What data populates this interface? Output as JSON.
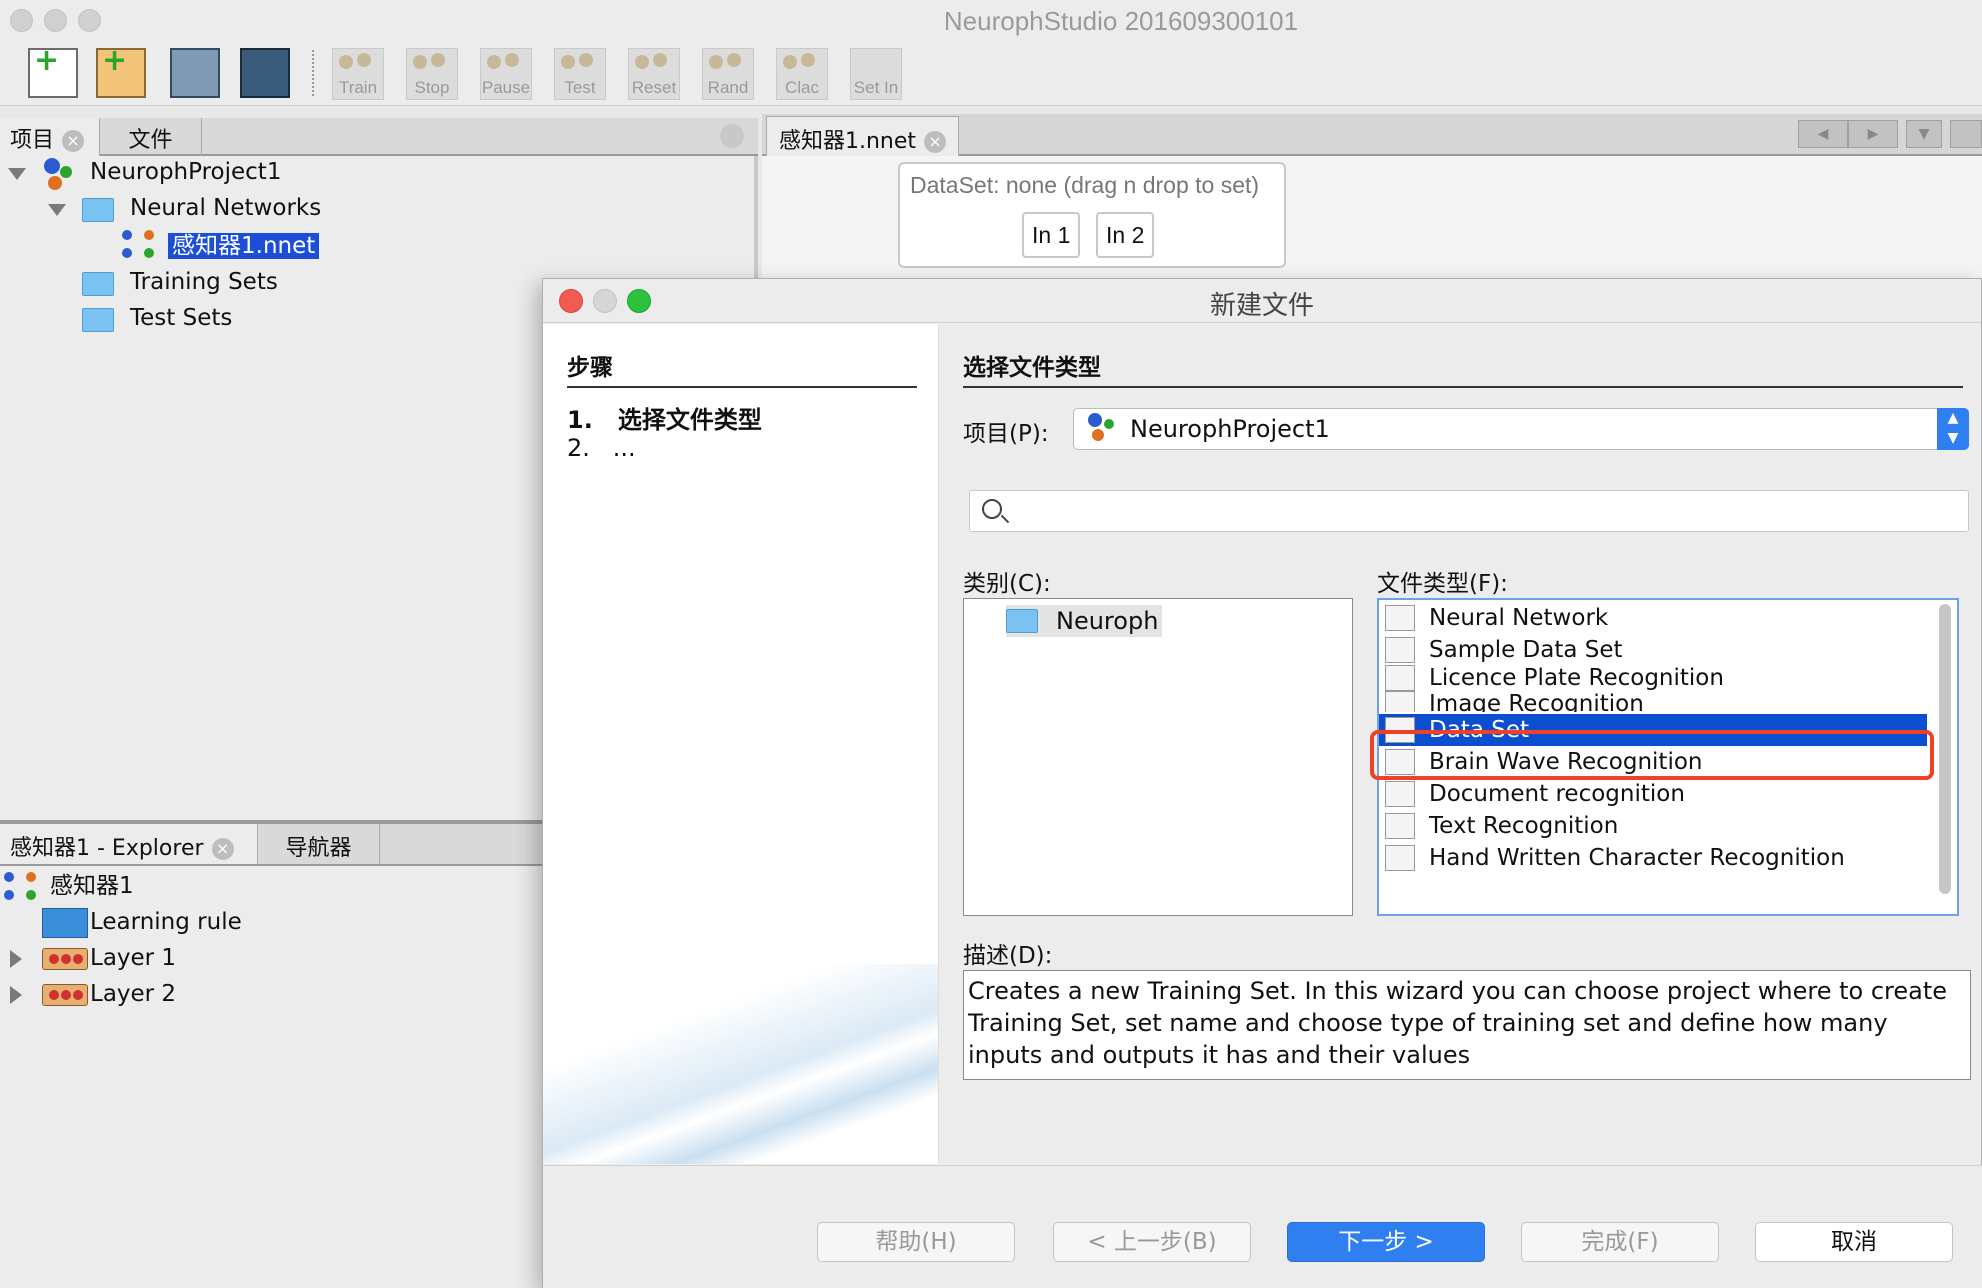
{
  "window": {
    "title": "NeurophStudio 201609300101"
  },
  "toolbar": {
    "train": "Train",
    "stop": "Stop",
    "pause": "Pause",
    "test": "Test",
    "reset": "Reset",
    "rand": "Rand",
    "calc": "Clac",
    "set_in": "Set In"
  },
  "project_panel": {
    "tabs": [
      "项目",
      "文件"
    ],
    "tree": {
      "project": "NeurophProject1",
      "neural_networks": "Neural Networks",
      "network_file": "感知器1.nnet",
      "training_sets": "Training Sets",
      "test_sets": "Test Sets"
    }
  },
  "explorer_panel": {
    "tabs": [
      "感知器1 - Explorer",
      "导航器"
    ],
    "root": "感知器1",
    "items": [
      "Learning rule",
      "Layer 1",
      "Layer 2"
    ]
  },
  "editor": {
    "tab": "感知器1.nnet",
    "dataset_label": "DataSet: none (drag n drop to set)",
    "inputs": [
      "In 1",
      "In 2"
    ]
  },
  "dialog": {
    "title": "新建文件",
    "steps_heading": "步骤",
    "steps": [
      {
        "num": "1.",
        "label": "选择文件类型"
      },
      {
        "num": "2.",
        "label": "..."
      }
    ],
    "section_heading": "选择文件类型",
    "project_label": "项目(P):",
    "project_value": "NeurophProject1",
    "search_placeholder": "",
    "categories_label": "类别(C):",
    "categories": [
      "Neuroph"
    ],
    "filetypes_label": "文件类型(F):",
    "filetypes": [
      "Neural Network",
      "Sample Data Set",
      "Licence Plate Recognition",
      "Image Recognition",
      "Data Set",
      "Brain Wave Recognition",
      "Document recognition",
      "Text Recognition",
      "Hand Written Character Recognition"
    ],
    "selected_filetype": "Data Set",
    "description_label": "描述(D):",
    "description": "Creates a new Training Set. In this wizard you can choose project where to create Training Set, set name and choose type of training set and define how many inputs and outputs it has and their values",
    "buttons": {
      "help": "帮助(H)",
      "back": "< 上一步(B)",
      "next": "下一步 >",
      "finish": "完成(F)",
      "cancel": "取消"
    }
  },
  "colors": {
    "selection": "#0b4fd0",
    "highlight_frame": "#f04028",
    "primary_button": "#2f7ff0"
  }
}
